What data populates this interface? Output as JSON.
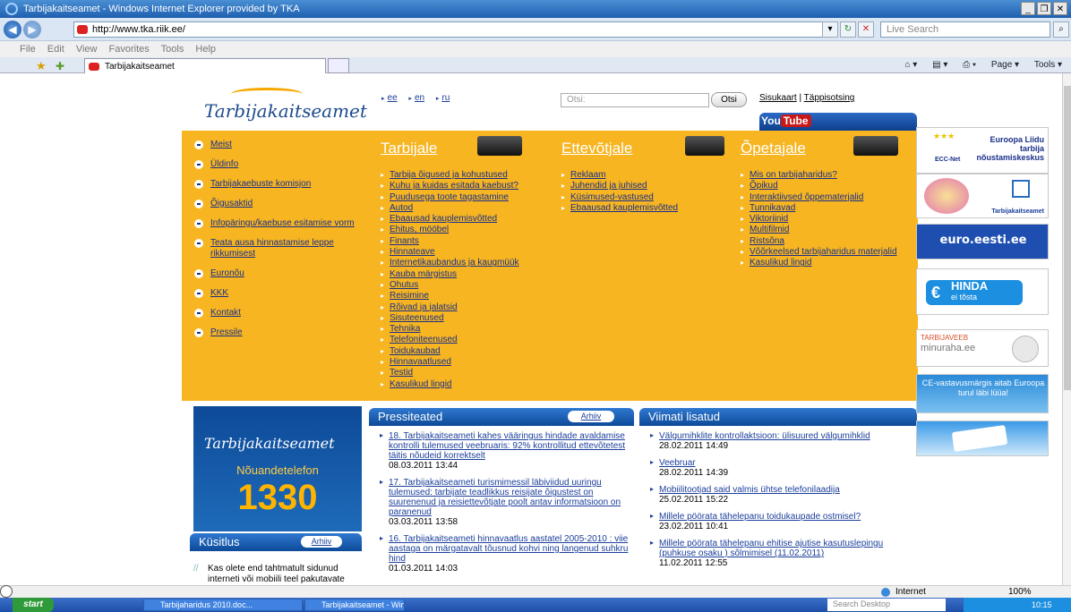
{
  "browser": {
    "title": "Tarbijakaitseamet - Windows Internet Explorer provided by TKA",
    "url": "http://www.tka.riik.ee/",
    "search_placeholder": "Live Search",
    "menu": [
      "File",
      "Edit",
      "View",
      "Favorites",
      "Tools",
      "Help"
    ],
    "tab_label": "Tarbijakaitseamet",
    "tools": [
      "Page ▾",
      "Tools ▾"
    ]
  },
  "site": {
    "logo": "Tarbijakaitseamet",
    "lang": [
      "ee",
      "en",
      "ru"
    ],
    "search_placeholder": "Otsi:",
    "search_button": "Otsi",
    "sitemap": "Sisukaart",
    "advanced": "Täppisotsing",
    "youtube": {
      "you": "You",
      "tube": "Tube"
    }
  },
  "leftnav": [
    "Meist",
    "Üldinfo",
    "Tarbijakaebuste komisjon",
    "Õigusaktid",
    "Infopäringu/kaebuse esitamise vorm",
    "Teata ausa hinnastamise leppe rikkumisest",
    "Euronõu",
    "KKK",
    "Kontakt",
    "Pressile"
  ],
  "columns": {
    "tarbijale": {
      "title": "Tarbijale",
      "items": [
        "Tarbija õigused ja kohustused",
        "Kuhu ja kuidas esitada kaebust?",
        "Puudusega toote tagastamine",
        "Autod",
        "Ebaausad kauplemisvõtted",
        "Ehitus, mööbel",
        "Finants",
        "Hinnateave",
        "Internetikaubandus ja kaugmüük",
        "Kauba märgistus",
        "Ohutus",
        "Reisimine",
        "Rõivad ja jalatsid",
        "Sisuteenused",
        "Tehnika",
        "Telefoniteenused",
        "Toidukaubad",
        "Hinnavaatlused",
        "Testid",
        "Kasulikud lingid"
      ]
    },
    "ettevotjale": {
      "title": "Ettevõtjale",
      "items": [
        "Reklaam",
        "Juhendid ja juhised",
        "Küsimused-vastused",
        "Ebaausad kauplemisvõtted"
      ]
    },
    "opetajale": {
      "title": "Õpetajale",
      "items": [
        "Mis on tarbijaharidus?",
        "Õpikud",
        "Interaktiivsed õppematerjalid",
        "Tunnikavad",
        "Viktoriinid",
        "Multifilmid",
        "Ristsõna",
        "Võõrkeelsed tarbijaharidus materjalid",
        "Kasulikud lingid"
      ]
    }
  },
  "promo": {
    "logo": "Tarbijakaitseamet",
    "tag": "Nõuandetelefon",
    "number": "1330"
  },
  "press": {
    "title": "Pressiteated",
    "archive": "Arhiiv",
    "items": [
      {
        "text": "18. Tarbijakaitseameti kahes vääringus hindade avaldamise kontrolli tulemused veebruaris: 92% kontrollitud ettevõtetest täitis nõudeid korrektselt",
        "date": "08.03.2011 13:44"
      },
      {
        "text": "17. Tarbijakaitseameti turismimessil läbiviidud uuringu tulemused: tarbijate teadlikkus reisijate õigustest on suurenenud ja reisiettevõtjate poolt antav informatsioon on paranenud",
        "date": "03.03.2011 13:58"
      },
      {
        "text": "16. Tarbijakaitseameti hinnavaatlus aastatel 2005-2010 : viie aastaga on märgatavalt tõusnud kohvi ning langenud suhkru hind",
        "date": "01.03.2011 14:03"
      }
    ]
  },
  "latest": {
    "title": "Viimati lisatud",
    "items": [
      {
        "text": "Välgumihklite kontrollaktsioon: ülisuured välgumihklid",
        "date": "28.02.2011 14:49"
      },
      {
        "text": "Veebruar",
        "date": "28.02.2011 14:39"
      },
      {
        "text": "Mobiilitootjad said valmis ühtse telefonilaadija",
        "date": "25.02.2011 15:22"
      },
      {
        "text": "Millele pöörata tähelepanu toidukaupade ostmisel?",
        "date": "23.02.2011 10:41"
      },
      {
        "text": "Millele pöörata tähelepanu ehitise ajutise kasutuslepingu (puhkuse osaku ) sõlmimisel (11.02.2011)",
        "date": "11.02.2011 12:55"
      }
    ]
  },
  "poll": {
    "title": "Küsitlus",
    "archive": "Arhiiv",
    "question": "Kas olete end tahtmatult sidunud interneti või mobiili teel pakutavate"
  },
  "banners": {
    "ecc": "Euroopa Liidu tarbija nõustamiskeskus",
    "ecc_net": "ECC-Net",
    "tka": "Tarbijakaitseamet",
    "euro": "euro.eesti.ee",
    "hinda": "HINDA",
    "hinda_sub": "ei tõsta",
    "minuraha_top": "TARBIJAVEEB",
    "minuraha": "minuraha.ee",
    "ce": "CE-vastavusmärgis aitab Euroopa turul läbi lüüa!"
  },
  "status": {
    "zone": "Internet",
    "zoom": "100%"
  },
  "taskbar": {
    "start": "start",
    "tasks": [
      "Tarbijaharidus 2010.doc...",
      "Tarbijakaitseamet - Wind..."
    ],
    "search": "Search Desktop",
    "clock": "10:15"
  }
}
